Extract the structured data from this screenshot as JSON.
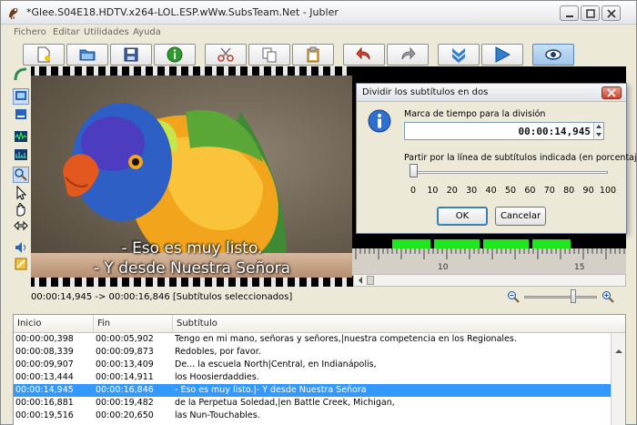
{
  "window": {
    "title": "*Glee.S04E18.HDTV.x264-LOL.ESP.wWw.SubsTeam.Net - Jubler"
  },
  "menu": [
    "Fichero",
    "Editar",
    "Utilidades",
    "Ayuda"
  ],
  "video": {
    "subtitle_lines": [
      "- Eso es muy listo.",
      "- Y desde Nuestra Señora"
    ]
  },
  "waveform": {
    "ruler_labels": [
      "10",
      "15"
    ]
  },
  "status": {
    "time_info": "00:00:14,945 -> 00:00:16,846 [Subtítulos seleccionados]"
  },
  "table": {
    "headers": [
      "Inicio",
      "Fin",
      "Subtítulo"
    ],
    "rows": [
      {
        "start": "00:00:00,398",
        "end": "00:00:05,902",
        "text": "Tengo en mi mano, señoras y señores,|nuestra competencia en los Regionales."
      },
      {
        "start": "00:00:08,339",
        "end": "00:00:09,873",
        "text": "Redobles, por favor."
      },
      {
        "start": "00:00:09,907",
        "end": "00:00:13,409",
        "text": "De... la escuela North|Central, en Indianápolis,"
      },
      {
        "start": "00:00:13,444",
        "end": "00:00:14,911",
        "text": "los Hoosierdaddies."
      },
      {
        "start": "00:00:14,945",
        "end": "00:00:16,846",
        "text": "- Eso es muy listo.|- Y desde Nuestra Señora"
      },
      {
        "start": "00:00:16,881",
        "end": "00:00:19,482",
        "text": "de la Perpetua Soledad,|en Battle Creek, Michigan,"
      },
      {
        "start": "00:00:19,516",
        "end": "00:00:20,650",
        "text": "las Nun-Touchables."
      }
    ],
    "selected_index": 4
  },
  "dialog": {
    "title": "Dividir los subtítulos en dos",
    "time_label": "Marca de tiempo para la división",
    "time_value": "00:00:14,945",
    "split_label": "Partir por la línea de subtítulos indicada (en porcentaje)",
    "slider_value_percent": 0,
    "ticks": [
      "0",
      "10",
      "20",
      "30",
      "40",
      "50",
      "60",
      "70",
      "80",
      "90",
      "100"
    ],
    "ok_label": "OK",
    "cancel_label": "Cancelar"
  },
  "colors": {
    "selection": "#3399ff",
    "waveform_green": "#1fe81f",
    "dialog_close": "#c9452d"
  }
}
